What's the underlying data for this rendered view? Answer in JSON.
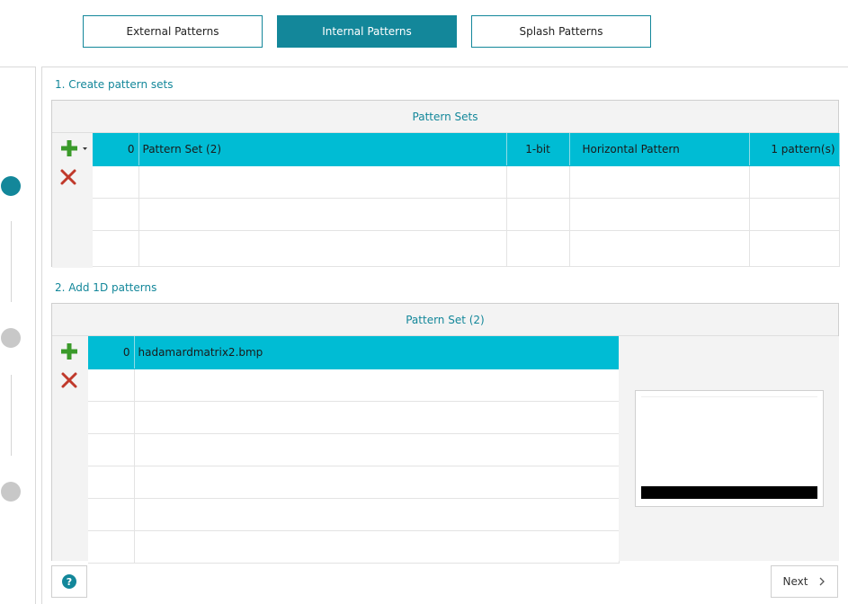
{
  "tabs": [
    {
      "label": "External Patterns",
      "active": false
    },
    {
      "label": "Internal Patterns",
      "active": true
    },
    {
      "label": "Splash Patterns",
      "active": false
    }
  ],
  "steps": [
    {
      "state": "active"
    },
    {
      "state": "inactive"
    },
    {
      "state": "inactive"
    }
  ],
  "section1": {
    "title": "1. Create pattern sets",
    "header": "Pattern Sets",
    "rows": [
      {
        "index": "0",
        "name": "Pattern Set (2)",
        "bit_depth": "1-bit",
        "direction": "Horizontal Pattern",
        "count": "1 pattern(s)",
        "selected": true
      }
    ]
  },
  "section2": {
    "title": "2. Add 1D patterns",
    "header": "Pattern Set (2)",
    "rows": [
      {
        "index": "0",
        "file": "hadamardmatrix2.bmp",
        "selected": true
      }
    ]
  },
  "footer": {
    "help_label": "?",
    "next_label": "Next"
  },
  "colors": {
    "accent": "#13879a",
    "selection": "#00bcd4",
    "add_icon": "#3a9a2a",
    "delete_icon": "#c0392b"
  }
}
